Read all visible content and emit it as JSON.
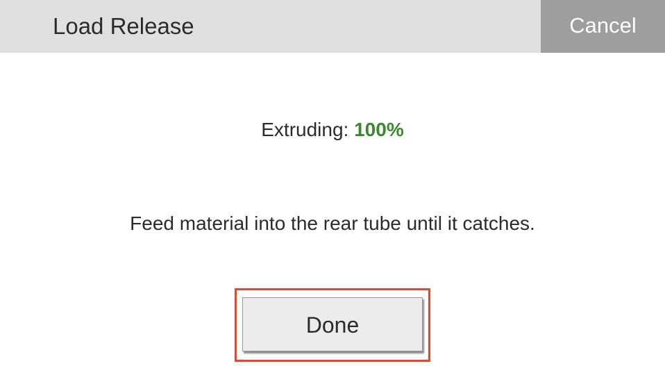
{
  "header": {
    "title": "Load Release",
    "cancel_label": "Cancel"
  },
  "status": {
    "label": "Extruding:",
    "value": "100%",
    "value_color": "#3a8a2c"
  },
  "instruction": "Feed material into the rear tube until it catches.",
  "actions": {
    "done_label": "Done",
    "highlight_color": "#e8452d"
  }
}
